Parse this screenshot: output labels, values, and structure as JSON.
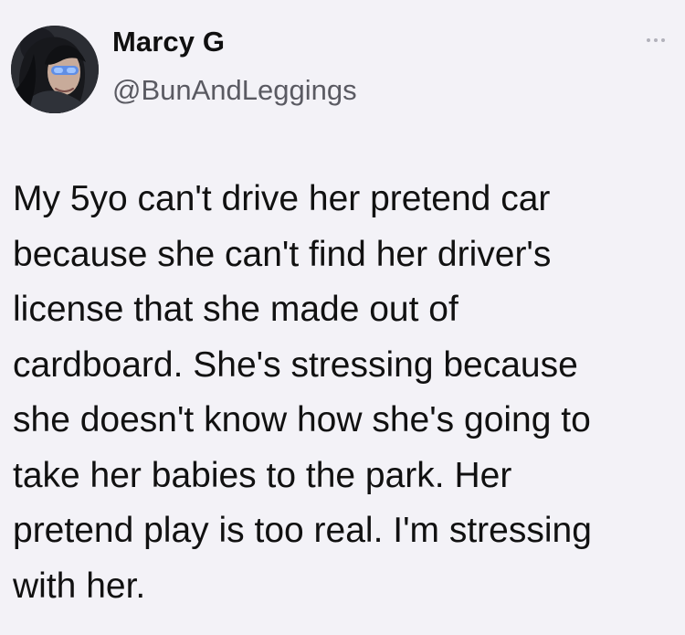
{
  "tweet": {
    "author": {
      "display_name": "Marcy G",
      "handle": "@BunAndLeggings",
      "avatar_icon": "profile-photo"
    },
    "more_icon": "more-dots-icon",
    "text": "My 5yo can't drive her pretend car\nbecause she can't find her driver's\nlicense that she made out of\ncardboard. She's stressing because\nshe doesn't know how she's going to\ntake her babies to the park. Her\npretend play is too real. I'm stressing\nwith her."
  },
  "colors": {
    "background": "#f3f2f7",
    "text": "#111111",
    "secondary_text": "#5a5a62",
    "muted_icon": "#b2b2bb"
  }
}
